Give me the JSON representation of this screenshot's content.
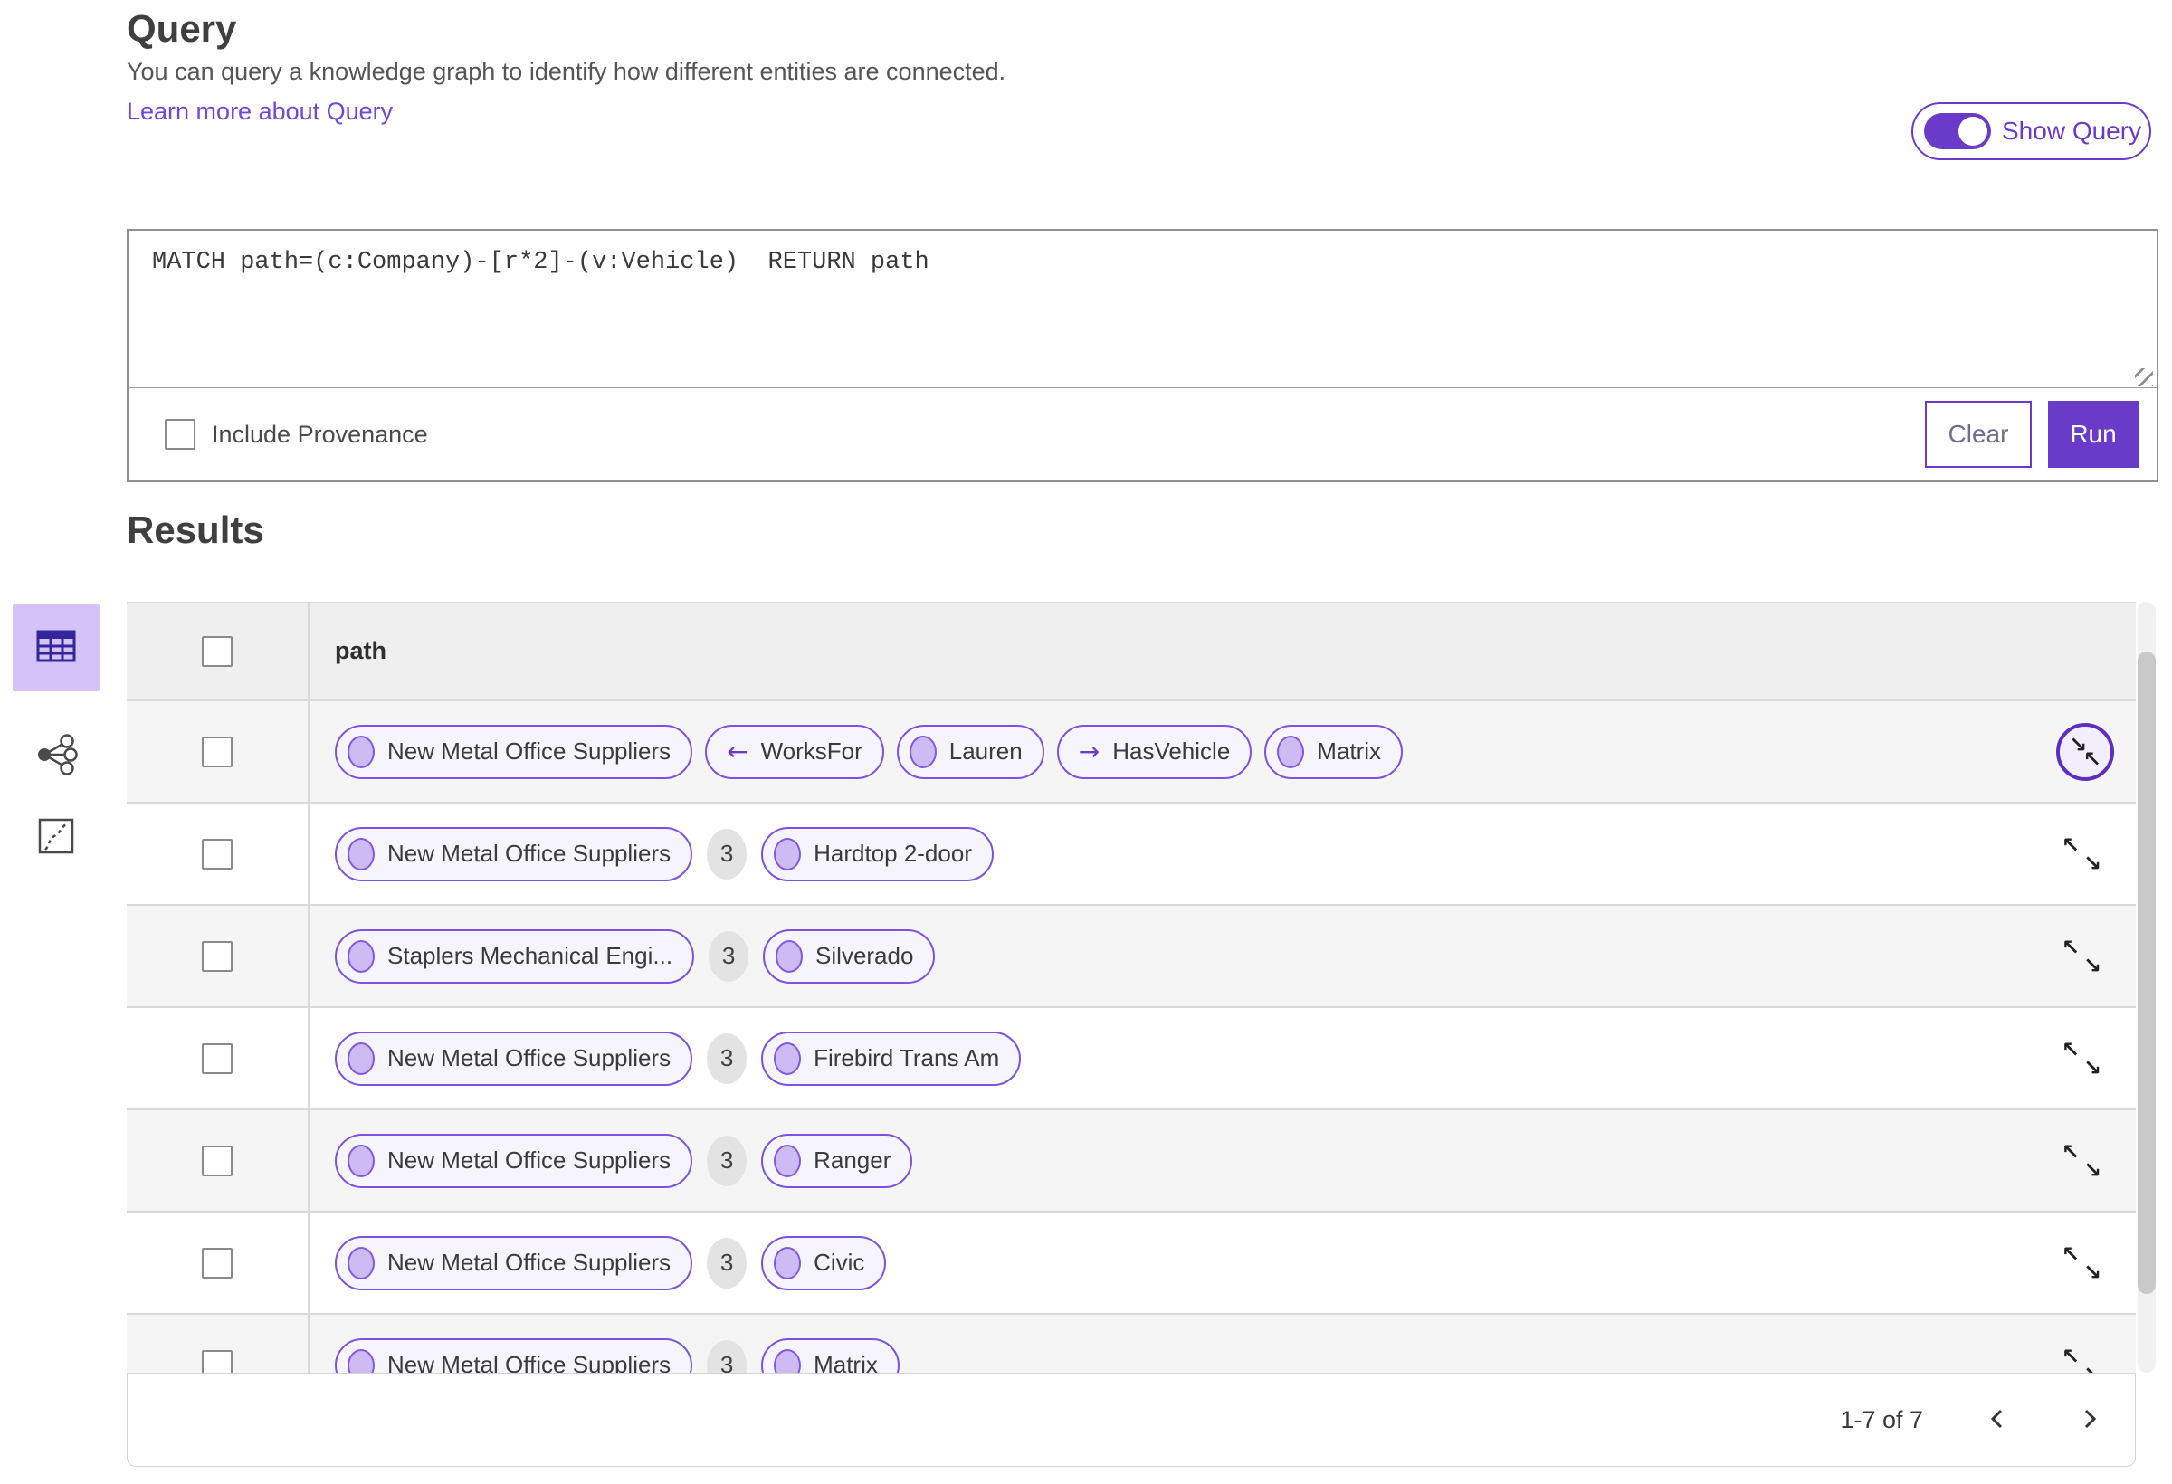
{
  "colors": {
    "accent": "#6a3bc9",
    "pill_border": "#7c52e0",
    "pill_bg": "#f6f4fc",
    "entity_dot": "#cdbcf3",
    "selected_view_bg": "#d4c3f8",
    "link": "#7146d9",
    "count_badge_bg": "#e3e3e3",
    "header_row_bg": "#efefef",
    "alt_row_bg": "#f5f5f5"
  },
  "query_section": {
    "title": "Query",
    "description": "You can query a knowledge graph to identify how different entities are connected.",
    "learn_more_link": "Learn more about Query",
    "show_query_label": "Show Query",
    "show_query_on": true,
    "query_text": "MATCH path=(c:Company)-[r*2]-(v:Vehicle)  RETURN path",
    "include_provenance_label": "Include Provenance",
    "include_provenance_checked": false,
    "clear_button": "Clear",
    "run_button": "Run"
  },
  "results_section": {
    "title": "Results",
    "column_header": "path",
    "views": [
      {
        "name": "table-view",
        "selected": true
      },
      {
        "name": "graph-view",
        "selected": false
      },
      {
        "name": "map-view",
        "selected": false
      }
    ],
    "rows": [
      {
        "expander": "collapse-circled",
        "items": [
          {
            "type": "entity",
            "label": "New Metal Office Suppliers"
          },
          {
            "type": "relation",
            "direction": "left",
            "label": "WorksFor"
          },
          {
            "type": "entity",
            "label": "Lauren"
          },
          {
            "type": "relation",
            "direction": "right",
            "label": "HasVehicle"
          },
          {
            "type": "entity",
            "label": "Matrix"
          }
        ]
      },
      {
        "expander": "expand",
        "items": [
          {
            "type": "entity",
            "label": "New Metal Office Suppliers"
          },
          {
            "type": "count",
            "label": "3"
          },
          {
            "type": "entity",
            "label": "Hardtop 2-door"
          }
        ]
      },
      {
        "expander": "expand",
        "items": [
          {
            "type": "entity",
            "label": "Staplers Mechanical Engi..."
          },
          {
            "type": "count",
            "label": "3"
          },
          {
            "type": "entity",
            "label": "Silverado"
          }
        ]
      },
      {
        "expander": "expand",
        "items": [
          {
            "type": "entity",
            "label": "New Metal Office Suppliers"
          },
          {
            "type": "count",
            "label": "3"
          },
          {
            "type": "entity",
            "label": "Firebird Trans Am"
          }
        ]
      },
      {
        "expander": "expand",
        "items": [
          {
            "type": "entity",
            "label": "New Metal Office Suppliers"
          },
          {
            "type": "count",
            "label": "3"
          },
          {
            "type": "entity",
            "label": "Ranger"
          }
        ]
      },
      {
        "expander": "expand",
        "items": [
          {
            "type": "entity",
            "label": "New Metal Office Suppliers"
          },
          {
            "type": "count",
            "label": "3"
          },
          {
            "type": "entity",
            "label": "Civic"
          }
        ]
      },
      {
        "expander": "expand",
        "items": [
          {
            "type": "entity",
            "label": "New Metal Office Suppliers"
          },
          {
            "type": "count",
            "label": "3"
          },
          {
            "type": "entity",
            "label": "Matrix"
          }
        ]
      }
    ],
    "pagination": {
      "range_label": "1-7 of 7"
    }
  }
}
